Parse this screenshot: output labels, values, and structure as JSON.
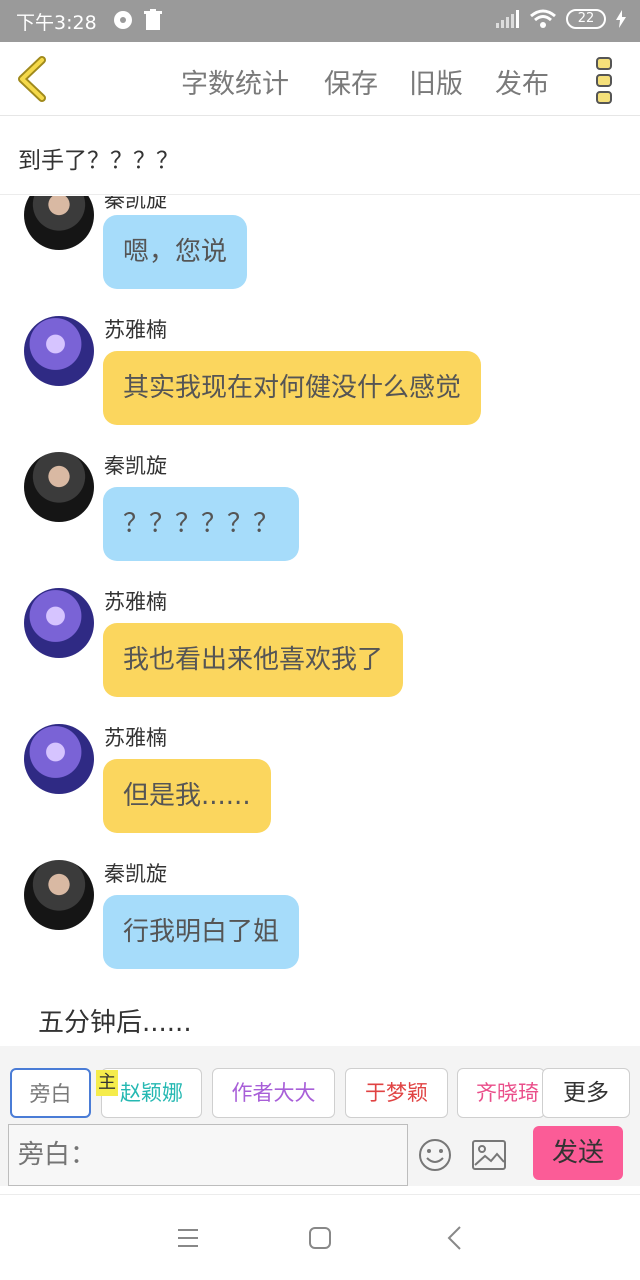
{
  "status_bar": {
    "time": "下午3:28",
    "battery": "22"
  },
  "toolbar": {
    "word_count": "字数统计",
    "save": "保存",
    "old_version": "旧版",
    "publish": "发布"
  },
  "title": "到手了？？？？",
  "messages": [
    {
      "sender": "秦凯旋",
      "text": "嗯，您说"
    },
    {
      "sender": "苏雅楠",
      "text": "其实我现在对何健没什么感觉"
    },
    {
      "sender": "秦凯旋",
      "text": "？？？？？？"
    },
    {
      "sender": "苏雅楠",
      "text": "我也看出来他喜欢我了"
    },
    {
      "sender": "苏雅楠",
      "text": "但是我......"
    },
    {
      "sender": "秦凯旋",
      "text": "行我明白了姐"
    }
  ],
  "narration": "五分钟后......",
  "roles": {
    "narrator": "旁白",
    "host_badge": "主",
    "zhao": "赵颖娜",
    "author": "作者大大",
    "yu": "于梦颖",
    "qi": "齐晓琦",
    "more": "更多"
  },
  "colors": {
    "zhao": "#25b8b2",
    "author": "#a85fd8",
    "yu": "#e04343",
    "qi": "#ea4e8a",
    "bubble_blue": "#a6dcfa",
    "bubble_yellow": "#fbd65e",
    "send": "#fb5c97"
  },
  "input": {
    "placeholder": "旁白：",
    "send": "发送"
  }
}
